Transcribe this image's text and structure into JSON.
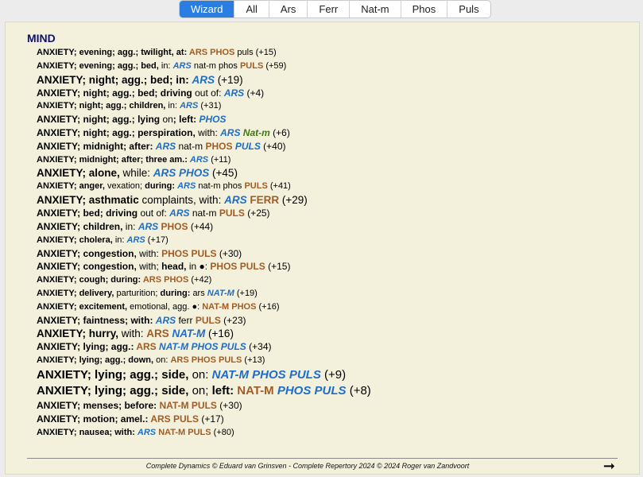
{
  "tabs": [
    {
      "label": "Wizard",
      "active": true
    },
    {
      "label": "All",
      "active": false
    },
    {
      "label": "Ars",
      "active": false
    },
    {
      "label": "Ferr",
      "active": false
    },
    {
      "label": "Nat-m",
      "active": false
    },
    {
      "label": "Phos",
      "active": false
    },
    {
      "label": "Puls",
      "active": false
    }
  ],
  "heading": "MIND",
  "rubrics": [
    {
      "size": 1,
      "parts": [
        [
          "k",
          "ANXIETY; evening; agg.; twilight, at: "
        ],
        [
          "rb",
          "ARS PHOS"
        ],
        [
          "rn",
          " puls"
        ],
        [
          "c",
          " (+15)"
        ]
      ]
    },
    {
      "size": 1,
      "parts": [
        [
          "k",
          "ANXIETY; evening; agg.; bed, "
        ],
        [
          "n",
          "in: "
        ],
        [
          "ri",
          "ARS"
        ],
        [
          "rn",
          " nat-m phos "
        ],
        [
          "rb",
          "PULS"
        ],
        [
          "c",
          " (+59)"
        ]
      ]
    },
    {
      "size": 3,
      "parts": [
        [
          "k",
          "ANXIETY; night; agg.; bed; in: "
        ],
        [
          "ri",
          "ARS"
        ],
        [
          "c",
          " (+19)"
        ]
      ]
    },
    {
      "size": 2,
      "parts": [
        [
          "k",
          "ANXIETY; night; agg.; bed; driving "
        ],
        [
          "n",
          "out of: "
        ],
        [
          "ri",
          "ARS"
        ],
        [
          "c",
          " (+4)"
        ]
      ]
    },
    {
      "size": 1,
      "parts": [
        [
          "k",
          "ANXIETY; night; agg.; children, "
        ],
        [
          "n",
          "in: "
        ],
        [
          "ri",
          "ARS"
        ],
        [
          "c",
          " (+31)"
        ]
      ]
    },
    {
      "size": 2,
      "parts": [
        [
          "k",
          "ANXIETY; night; agg.; lying "
        ],
        [
          "n",
          "on"
        ],
        [
          "k",
          "; left: "
        ],
        [
          "ri",
          "PHOS"
        ]
      ]
    },
    {
      "size": 2,
      "parts": [
        [
          "k",
          "ANXIETY; night; agg.; perspiration, "
        ],
        [
          "n",
          "with: "
        ],
        [
          "ri",
          "ARS"
        ],
        [
          "rg",
          " Nat-m"
        ],
        [
          "c",
          " (+6)"
        ]
      ]
    },
    {
      "size": 2,
      "parts": [
        [
          "k",
          "ANXIETY; midnight; after: "
        ],
        [
          "ri",
          "ARS"
        ],
        [
          "rn",
          " nat-m "
        ],
        [
          "rb",
          "PHOS"
        ],
        [
          "ri",
          " PULS"
        ],
        [
          "c",
          " (+40)"
        ]
      ]
    },
    {
      "size": 1,
      "parts": [
        [
          "k",
          "ANXIETY; midnight; after; three am.: "
        ],
        [
          "ri",
          "ARS"
        ],
        [
          "c",
          " (+11)"
        ]
      ]
    },
    {
      "size": 3,
      "parts": [
        [
          "k",
          "ANXIETY; alone, "
        ],
        [
          "n",
          "while: "
        ],
        [
          "ri",
          "ARS PHOS"
        ],
        [
          "c",
          " (+45)"
        ]
      ]
    },
    {
      "size": 1,
      "parts": [
        [
          "k",
          "ANXIETY; anger, "
        ],
        [
          "n",
          "vexation; "
        ],
        [
          "k",
          "during: "
        ],
        [
          "ri",
          "ARS"
        ],
        [
          "rn",
          " nat-m phos "
        ],
        [
          "rb",
          "PULS"
        ],
        [
          "c",
          " (+41)"
        ]
      ]
    },
    {
      "size": 3,
      "parts": [
        [
          "k",
          "ANXIETY; asthmatic "
        ],
        [
          "n",
          "complaints, with: "
        ],
        [
          "ri",
          "ARS"
        ],
        [
          "rb",
          " FERR"
        ],
        [
          "c",
          " (+29)"
        ]
      ]
    },
    {
      "size": 2,
      "parts": [
        [
          "k",
          "ANXIETY; bed; driving "
        ],
        [
          "n",
          "out of: "
        ],
        [
          "ri",
          "ARS"
        ],
        [
          "rn",
          " nat-m "
        ],
        [
          "rb",
          "PULS"
        ],
        [
          "c",
          " (+25)"
        ]
      ]
    },
    {
      "size": 2,
      "parts": [
        [
          "k",
          "ANXIETY; children, "
        ],
        [
          "n",
          "in: "
        ],
        [
          "ri",
          "ARS"
        ],
        [
          "rb",
          " PHOS"
        ],
        [
          "c",
          " (+44)"
        ]
      ]
    },
    {
      "size": 1,
      "parts": [
        [
          "k",
          "ANXIETY; cholera, "
        ],
        [
          "n",
          "in: "
        ],
        [
          "ri",
          "ARS"
        ],
        [
          "c",
          " (+17)"
        ]
      ]
    },
    {
      "size": 2,
      "parts": [
        [
          "k",
          "ANXIETY; congestion, "
        ],
        [
          "n",
          "with: "
        ],
        [
          "rb",
          "PHOS PULS"
        ],
        [
          "c",
          " (+30)"
        ]
      ]
    },
    {
      "size": 2,
      "parts": [
        [
          "k",
          "ANXIETY; congestion, "
        ],
        [
          "n",
          "with; "
        ],
        [
          "k",
          "head, "
        ],
        [
          "n",
          "in ●: "
        ],
        [
          "rb",
          "PHOS PULS"
        ],
        [
          "c",
          " (+15)"
        ]
      ]
    },
    {
      "size": 1,
      "parts": [
        [
          "k",
          "ANXIETY; cough; during: "
        ],
        [
          "rb",
          "ARS PHOS"
        ],
        [
          "c",
          " (+42)"
        ]
      ]
    },
    {
      "size": 1,
      "parts": [
        [
          "k",
          "ANXIETY; delivery, "
        ],
        [
          "n",
          "parturition; "
        ],
        [
          "k",
          "during: "
        ],
        [
          "rn",
          "ars "
        ],
        [
          "ri",
          "NAT-M"
        ],
        [
          "c",
          " (+19)"
        ]
      ]
    },
    {
      "size": 1,
      "parts": [
        [
          "k",
          "ANXIETY; excitement, "
        ],
        [
          "n",
          "emotional, agg. ●: "
        ],
        [
          "rb",
          "NAT-M PHOS"
        ],
        [
          "c",
          " (+16)"
        ]
      ]
    },
    {
      "size": 2,
      "parts": [
        [
          "k",
          "ANXIETY; faintness; with: "
        ],
        [
          "ri",
          "ARS"
        ],
        [
          "rn",
          " ferr "
        ],
        [
          "rb",
          "PULS"
        ],
        [
          "c",
          " (+23)"
        ]
      ]
    },
    {
      "size": 3,
      "parts": [
        [
          "k",
          "ANXIETY; hurry, "
        ],
        [
          "n",
          "with: "
        ],
        [
          "rb",
          "ARS"
        ],
        [
          "ri",
          " NAT-M"
        ],
        [
          "c",
          " (+16)"
        ]
      ]
    },
    {
      "size": 2,
      "parts": [
        [
          "k",
          "ANXIETY; lying; agg.: "
        ],
        [
          "rb",
          "ARS"
        ],
        [
          "ri",
          " NAT-M PHOS PULS"
        ],
        [
          "c",
          " (+34)"
        ]
      ]
    },
    {
      "size": 1,
      "parts": [
        [
          "k",
          "ANXIETY; lying; agg.; down, "
        ],
        [
          "n",
          "on: "
        ],
        [
          "rb",
          "ARS PHOS PULS"
        ],
        [
          "c",
          " (+13)"
        ]
      ]
    },
    {
      "size": 4,
      "parts": [
        [
          "k",
          "ANXIETY; lying; agg.; side, "
        ],
        [
          "n",
          "on: "
        ],
        [
          "ri",
          "NAT-M PHOS PULS"
        ],
        [
          "c",
          " (+9)"
        ]
      ]
    },
    {
      "size": 4,
      "parts": [
        [
          "k",
          "ANXIETY; lying; agg.; side, "
        ],
        [
          "n",
          "on; "
        ],
        [
          "k",
          "left: "
        ],
        [
          "rb",
          "NAT-M"
        ],
        [
          "ri",
          " PHOS PULS"
        ],
        [
          "c",
          " (+8)"
        ]
      ]
    },
    {
      "size": 2,
      "parts": [
        [
          "k",
          "ANXIETY; menses; before: "
        ],
        [
          "rb",
          "NAT-M PULS"
        ],
        [
          "c",
          " (+30)"
        ]
      ]
    },
    {
      "size": 2,
      "parts": [
        [
          "k",
          "ANXIETY; motion; amel.: "
        ],
        [
          "rb",
          "ARS PULS"
        ],
        [
          "c",
          " (+17)"
        ]
      ]
    },
    {
      "size": 1,
      "parts": [
        [
          "k",
          "ANXIETY; nausea; with: "
        ],
        [
          "ri",
          "ARS"
        ],
        [
          "rb",
          " NAT-M PULS"
        ],
        [
          "c",
          " (+80)"
        ]
      ]
    }
  ],
  "footer": "Complete Dynamics © Eduard van Grinsven   -   Complete Repertory 2024 © 2024 Roger van Zandvoort",
  "next_arrow": "➞",
  "colors": {
    "accent": "#2a7de1",
    "heading": "#10106e",
    "remedy_bold": "#a15c25",
    "remedy_italic": "#1e6dc7",
    "remedy_green": "#3d7a10",
    "panel_bg": "#f3f1dc"
  }
}
